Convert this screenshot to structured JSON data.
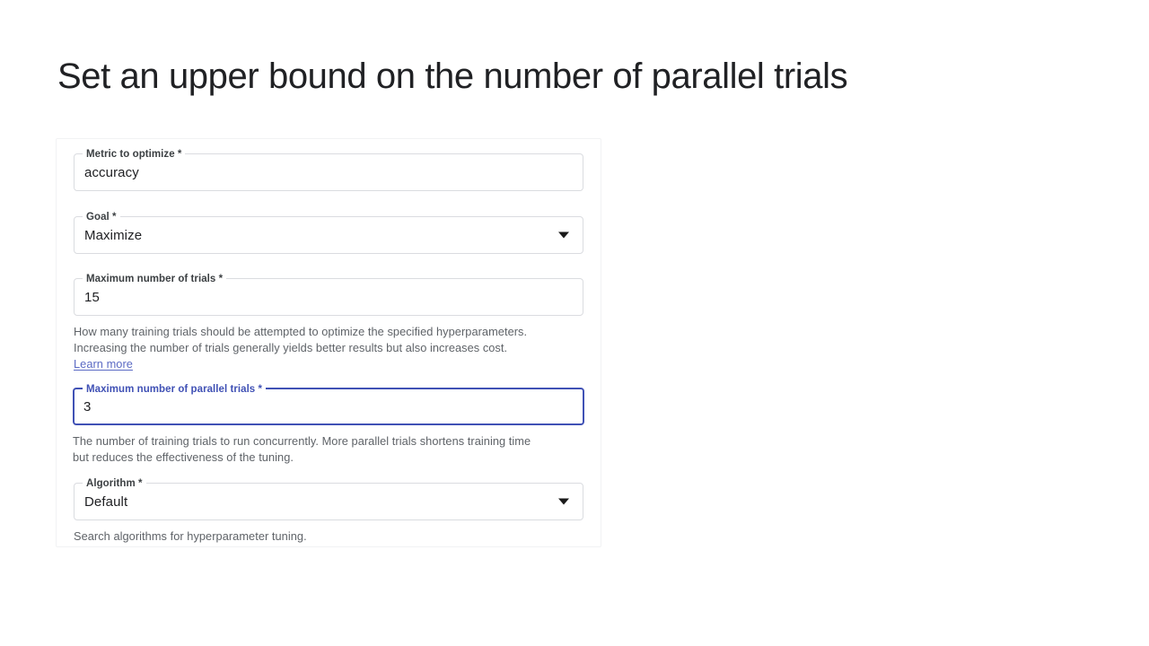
{
  "slide": {
    "title": "Set an upper bound on the number of parallel trials",
    "title_color": "#202124",
    "background_color": "#ffffff"
  },
  "theme": {
    "focus_color": "#4051b5",
    "link_color": "#5b6ac4",
    "border_color": "#dadce0",
    "helper_text_color": "#5f6368",
    "label_color": "#3c4043",
    "value_color": "#202124"
  },
  "form": {
    "fields": [
      {
        "id": "metric-to-optimize",
        "label": "Metric to optimize *",
        "value": "accuracy",
        "type": "text",
        "focused": false,
        "helper_lines": [],
        "link": null
      },
      {
        "id": "goal",
        "label": "Goal *",
        "value": "Maximize",
        "type": "select",
        "focused": false,
        "helper_lines": [],
        "link": null,
        "caret_icon": "chevron-down-icon"
      },
      {
        "id": "maximum-number-of-trials",
        "label": "Maximum number of trials *",
        "value": "15",
        "type": "number",
        "focused": false,
        "helper_lines": [
          "How many training trials should be attempted to optimize the specified hyperparameters.",
          "Increasing the number of trials generally yields better results but also increases cost."
        ],
        "link": "Learn more"
      },
      {
        "id": "maximum-number-of-parallel-trials",
        "label": "Maximum number of parallel trials *",
        "value": "3",
        "type": "number",
        "focused": true,
        "helper_lines": [
          "The number of training trials to run concurrently. More parallel trials shortens training time",
          "but reduces the effectiveness of the tuning."
        ],
        "link": null
      },
      {
        "id": "algorithm",
        "label": "Algorithm *",
        "value": "Default",
        "type": "select",
        "focused": false,
        "helper_lines": [
          "Search algorithms for hyperparameter tuning."
        ],
        "link": null,
        "caret_icon": "chevron-down-icon"
      }
    ]
  }
}
